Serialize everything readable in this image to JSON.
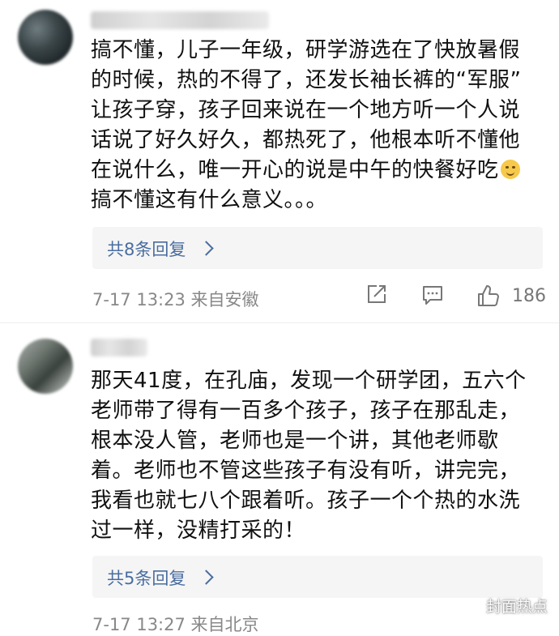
{
  "comments": [
    {
      "lines": [
        "搞不懂，儿子一年级，研学游选在了快放暑假",
        "的时候，热的不得了，还发长袖长裤的“军服”",
        "让孩子穿，孩子回来说在一个地方听一个人说",
        "话说了好久好久，都热死了，他根本听不懂他",
        "在说什么，唯一开心的说是中午的快餐好吃",
        "搞不懂这有什么意义。。。"
      ],
      "emoji_icon": "smile-emoji",
      "replies_label": "共8条回复",
      "meta": "7-17 13:23 来自安徽",
      "like_count": "186"
    },
    {
      "lines": [
        "那天41度，在孔庙，发现一个研学团，五六个",
        "老师带了得有一百多个孩子，孩子在那乱走，",
        "根本没人管，老师也是一个讲，其他老师歇",
        "着。老师也不管这些孩子有没有听，讲完完，",
        "我看也就七八个跟着听。孩子一个个热的水洗",
        "过一样，没精打采的！"
      ],
      "replies_label": "共5条回复",
      "meta": "7-17 13:27 来自北京"
    }
  ],
  "watermark": "封面热点",
  "colors": {
    "link": "#4a6da0",
    "meta": "#888888",
    "reply_bg": "#f5f5f5"
  }
}
